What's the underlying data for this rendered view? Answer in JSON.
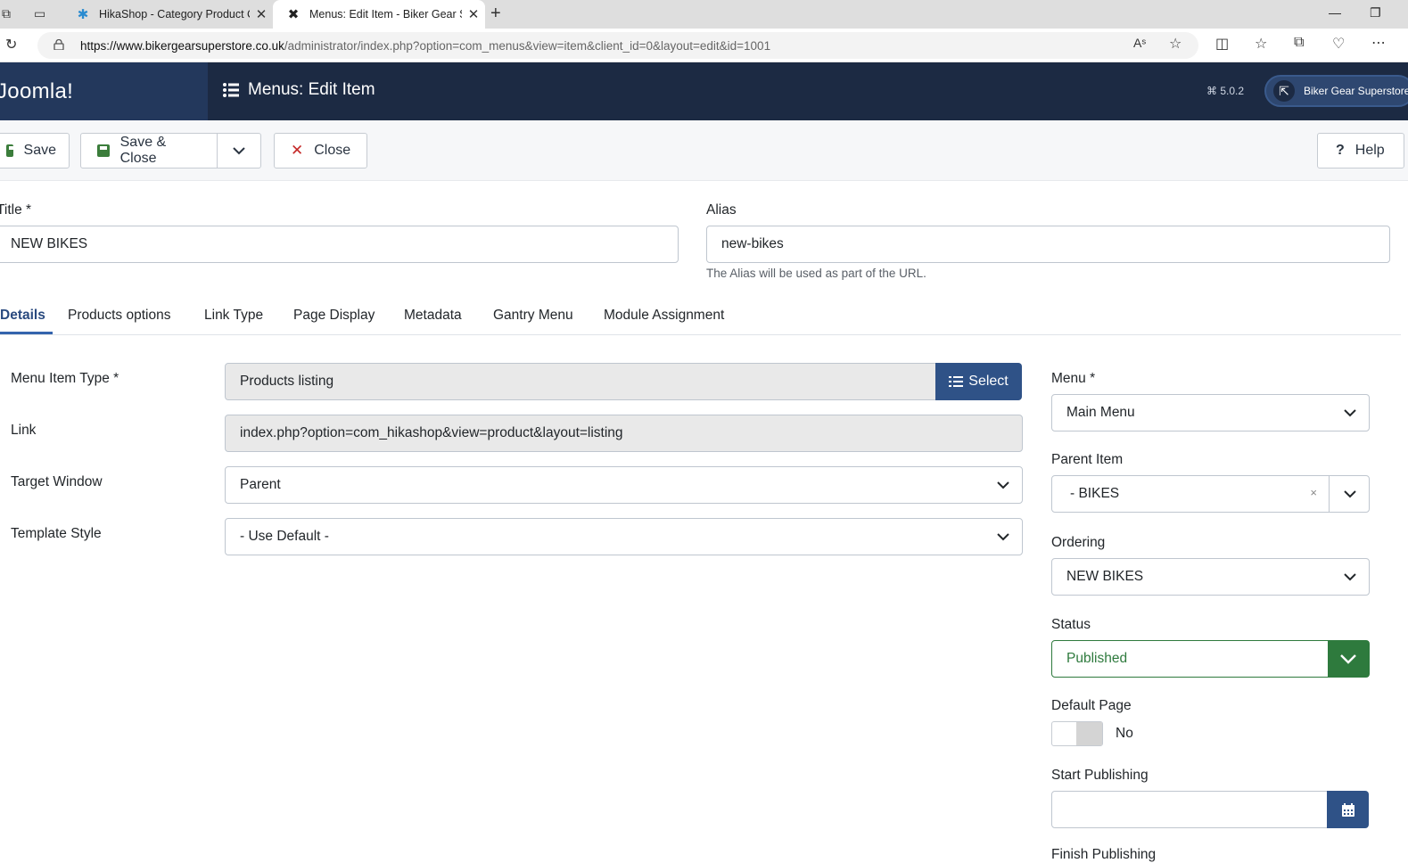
{
  "browser": {
    "tabs": [
      {
        "title": "HikaShop - Category Product Co",
        "icon": "hikashop-icon",
        "active": false
      },
      {
        "title": "Menus: Edit Item - Biker Gear Su",
        "icon": "joomla-icon",
        "active": true
      }
    ],
    "url_host": "https://www.bikergearsuperstore.co.uk",
    "url_path": "/administrator/index.php?option=com_menus&view=item&client_id=0&layout=edit&id=1001"
  },
  "header": {
    "logo": "Joomla!",
    "title": "Menus: Edit Item",
    "version": "5.0.2",
    "site_name": "Biker Gear Superstore"
  },
  "toolbar": {
    "save": "Save",
    "save_close": "Save & Close",
    "close": "Close",
    "help": "Help"
  },
  "form": {
    "title_label": "Title *",
    "title_value": "NEW BIKES",
    "alias_label": "Alias",
    "alias_value": "new-bikes",
    "alias_help": "The Alias will be used as part of the URL."
  },
  "tabs": [
    "Details",
    "Products options",
    "Link Type",
    "Page Display",
    "Metadata",
    "Gantry Menu",
    "Module Assignment"
  ],
  "details": {
    "menu_item_type_label": "Menu Item Type *",
    "menu_item_type_value": "Products listing",
    "select_button": "Select",
    "link_label": "Link",
    "link_value": "index.php?option=com_hikashop&view=product&layout=listing",
    "target_window_label": "Target Window",
    "target_window_value": "Parent",
    "template_style_label": "Template Style",
    "template_style_value": "- Use Default -"
  },
  "sidebar": {
    "menu_label": "Menu *",
    "menu_value": "Main Menu",
    "parent_label": "Parent Item",
    "parent_value": "- BIKES",
    "ordering_label": "Ordering",
    "ordering_value": "NEW BIKES",
    "status_label": "Status",
    "status_value": "Published",
    "default_page_label": "Default Page",
    "default_page_value": "No",
    "start_publishing_label": "Start Publishing",
    "finish_publishing_label": "Finish Publishing"
  },
  "colors": {
    "header_bg": "#1c2a43",
    "primary": "#2f5287",
    "success": "#2e7a3d",
    "danger": "#c52827"
  }
}
